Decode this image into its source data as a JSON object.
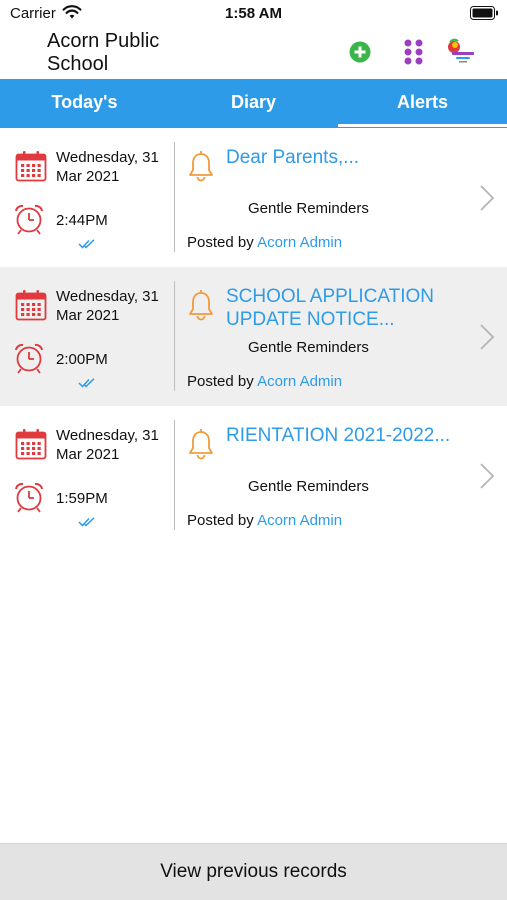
{
  "status_bar": {
    "carrier": "Carrier",
    "time": "1:58 AM"
  },
  "header": {
    "school_name": "Acorn Public School",
    "icons": [
      "add-icon",
      "grid-menu-icon",
      "school-logo"
    ]
  },
  "tabs": [
    {
      "label": "Today's",
      "active": false
    },
    {
      "label": "Diary",
      "active": false
    },
    {
      "label": "Alerts",
      "active": true
    }
  ],
  "records": [
    {
      "date": "Wednesday, 31 Mar 2021",
      "time": "2:44PM",
      "title": "Dear Parents,...",
      "category": "Gentle Reminders",
      "posted_by_label": "Posted by",
      "author": "Acorn Admin"
    },
    {
      "date": "Wednesday, 31 Mar 2021",
      "time": "2:00PM",
      "title": "SCHOOL APPLICATION UPDATE NOTICE...",
      "category": "Gentle Reminders",
      "posted_by_label": "Posted by",
      "author": "Acorn Admin"
    },
    {
      "date": "Wednesday, 31 Mar 2021",
      "time": "1:59PM",
      "title": "RIENTATION 2021-2022...",
      "category": "Gentle Reminders",
      "posted_by_label": "Posted by",
      "author": "Acorn Admin"
    }
  ],
  "footer": {
    "button_label": "View previous records"
  },
  "colors": {
    "accent": "#2e9be8",
    "calendar_red": "#e0393e",
    "bell_orange": "#f29a3a",
    "add_green": "#3bb54a",
    "menu_purple": "#9b3fc1"
  }
}
